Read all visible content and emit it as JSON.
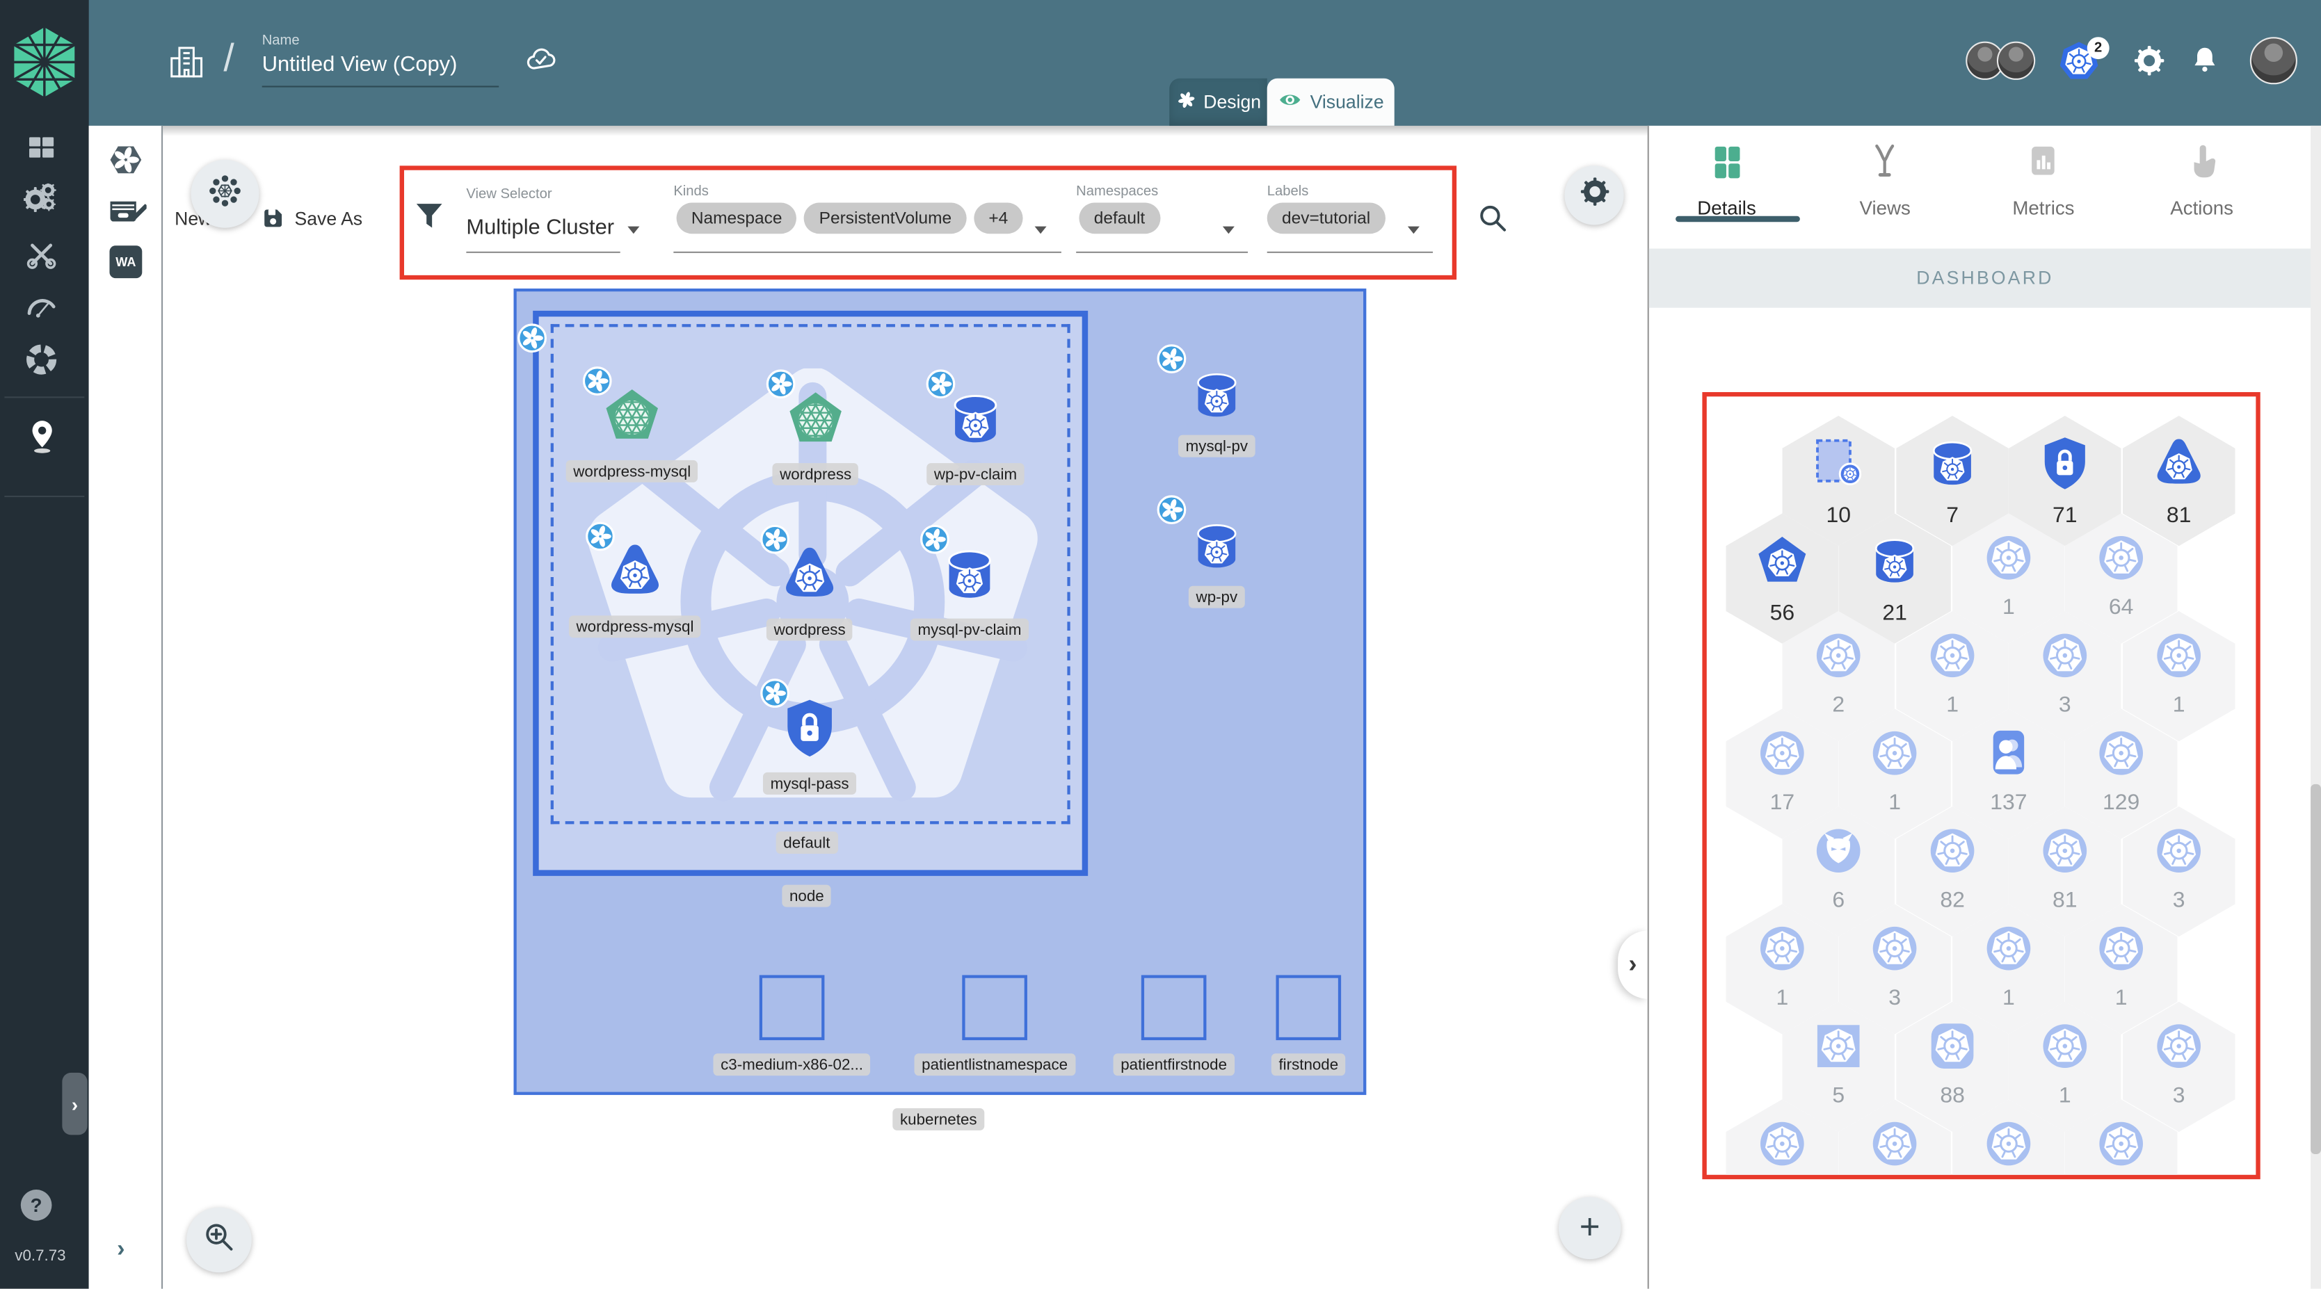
{
  "header": {
    "name_label": "Name",
    "name_value": "Untitled View (Copy)",
    "mode_design": "Design",
    "mode_visualize": "Visualize",
    "k8s_context_badge": "2"
  },
  "toolbar": {
    "new_label": "New",
    "save_as_label": "Save As",
    "view_selector_label": "View Selector",
    "view_selector_value": "Multiple Cluster",
    "kinds_label": "Kinds",
    "kind_chips": [
      "Namespace",
      "PersistentVolume",
      "+4"
    ],
    "namespaces_label": "Namespaces",
    "namespace_chips": [
      "default"
    ],
    "labels_label": "Labels",
    "label_chips": [
      "dev=tutorial"
    ],
    "wasm_label": "WA"
  },
  "panel": {
    "tabs": [
      {
        "label": "Details",
        "active": true
      },
      {
        "label": "Views",
        "active": false
      },
      {
        "label": "Metrics",
        "active": false
      },
      {
        "label": "Actions",
        "active": false
      }
    ],
    "section_title": "DASHBOARD",
    "hexagons": [
      {
        "icon": "namespace",
        "count": "10",
        "emph": true
      },
      {
        "icon": "cylinder",
        "count": "7",
        "emph": true
      },
      {
        "icon": "secret",
        "count": "71",
        "emph": true
      },
      {
        "icon": "triangle",
        "count": "81",
        "emph": true
      },
      {
        "icon": "pentagon",
        "count": "56",
        "emph": true
      },
      {
        "icon": "cylinder",
        "count": "21",
        "emph": true
      },
      {
        "icon": "k8s",
        "count": "1",
        "emph": false
      },
      {
        "icon": "k8s",
        "count": "64",
        "emph": false
      },
      {
        "icon": "k8s",
        "count": "2",
        "emph": false
      },
      {
        "icon": "k8s",
        "count": "1",
        "emph": false
      },
      {
        "icon": "k8s",
        "count": "3",
        "emph": false
      },
      {
        "icon": "k8s",
        "count": "1",
        "emph": false
      },
      {
        "icon": "k8s",
        "count": "17",
        "emph": false
      },
      {
        "icon": "k8s",
        "count": "1",
        "emph": false
      },
      {
        "icon": "user",
        "count": "137",
        "emph": false
      },
      {
        "icon": "k8s",
        "count": "129",
        "emph": false
      },
      {
        "icon": "daemon",
        "count": "6",
        "emph": false
      },
      {
        "icon": "k8s",
        "count": "82",
        "emph": false
      },
      {
        "icon": "k8s",
        "count": "81",
        "emph": false
      },
      {
        "icon": "k8s",
        "count": "3",
        "emph": false
      },
      {
        "icon": "k8s",
        "count": "1",
        "emph": false
      },
      {
        "icon": "k8s",
        "count": "3",
        "emph": false
      },
      {
        "icon": "k8s",
        "count": "1",
        "emph": false
      },
      {
        "icon": "k8s",
        "count": "1",
        "emph": false
      },
      {
        "icon": "k8sSquare",
        "count": "5",
        "emph": false
      },
      {
        "icon": "k8sRounded",
        "count": "88",
        "emph": false
      },
      {
        "icon": "k8s",
        "count": "1",
        "emph": false
      },
      {
        "icon": "k8s",
        "count": "3",
        "emph": false
      },
      {
        "icon": "k8s",
        "count": "",
        "emph": false
      },
      {
        "icon": "k8s",
        "count": "",
        "emph": false
      },
      {
        "icon": "k8s",
        "count": "",
        "emph": false
      },
      {
        "icon": "k8s",
        "count": "",
        "emph": false
      }
    ]
  },
  "canvas": {
    "cluster_label": "kubernetes",
    "node_label": "node",
    "namespace_label": "default",
    "workloads": [
      {
        "name": "wordpress-mysql",
        "icon": "pentagonGreen"
      },
      {
        "name": "wordpress",
        "icon": "pentagonGreen"
      },
      {
        "name": "wp-pv-claim",
        "icon": "cylinder"
      },
      {
        "name": "wordpress-mysql",
        "icon": "triangle"
      },
      {
        "name": "wordpress",
        "icon": "triangle"
      },
      {
        "name": "mysql-pv-claim",
        "icon": "cylinder"
      },
      {
        "name": "mysql-pass",
        "icon": "secret"
      }
    ],
    "volumes": [
      {
        "name": "mysql-pv",
        "icon": "cylinder"
      },
      {
        "name": "wp-pv",
        "icon": "cylinder"
      }
    ],
    "nodes": [
      "c3-medium-x86-02...",
      "patientlistnamespace",
      "patientfirstnode",
      "firstnode"
    ]
  },
  "statusbar": {
    "version": "v0.7.73",
    "help_label": "?"
  },
  "colors": {
    "accent_teal": "#4b7383",
    "green": "#4cae8f",
    "blue": "#3a6bd9",
    "light_blue": "#a9c0f1",
    "annotation_red": "#e8392b",
    "sidebar_dark": "#232e36"
  }
}
